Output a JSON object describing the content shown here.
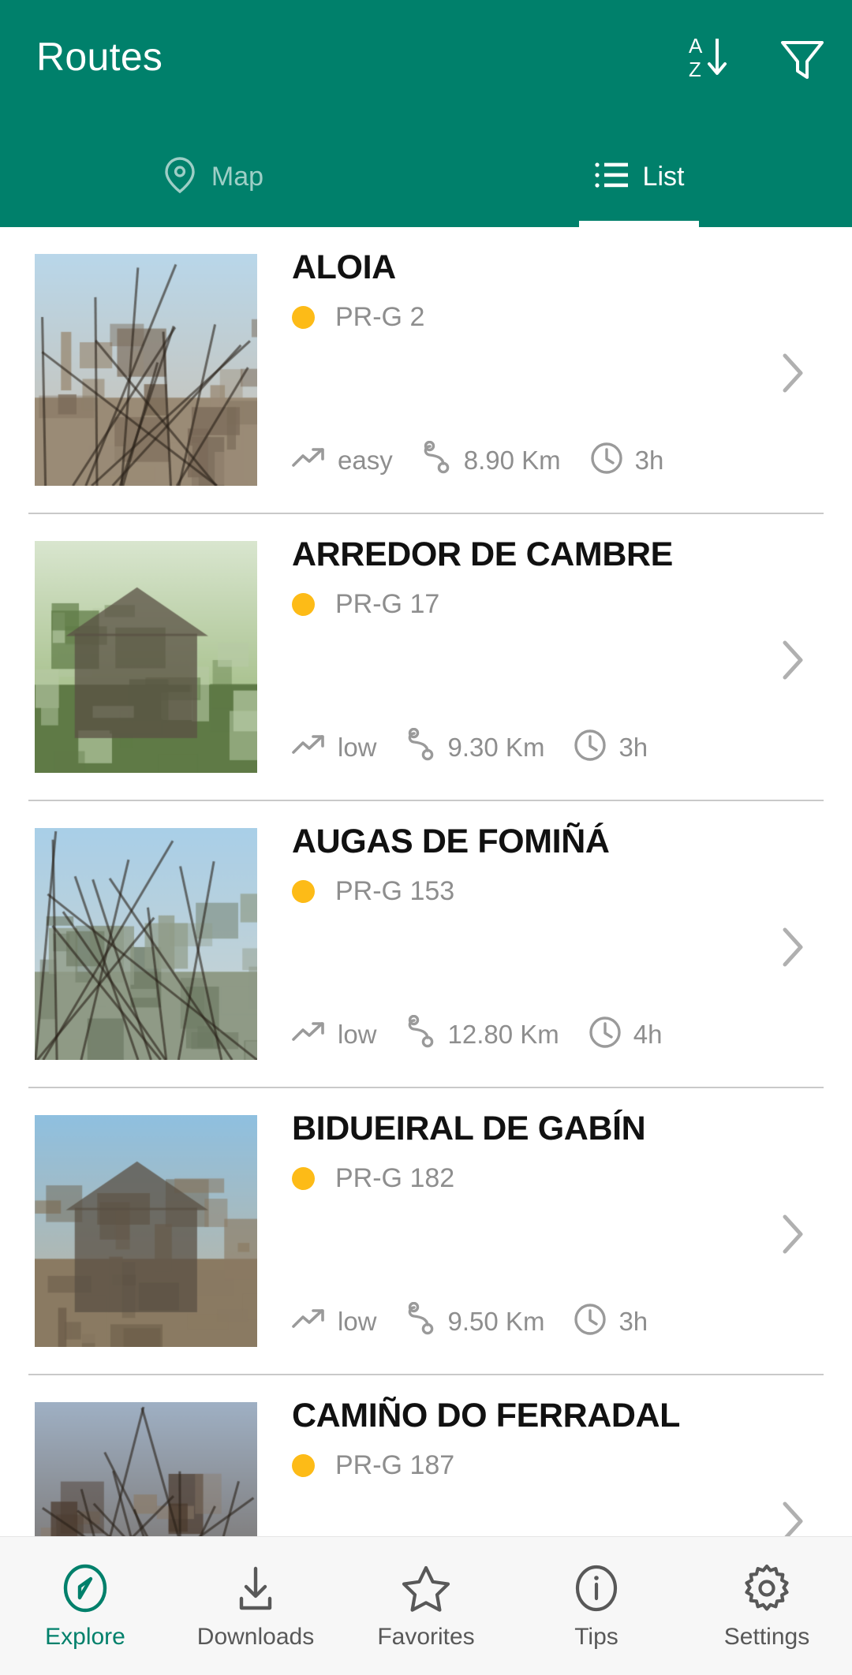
{
  "header": {
    "title": "Routes",
    "sort_icon": "sort-alpha-down-icon",
    "sort_label": "A-Z",
    "filter_icon": "filter-funnel-icon",
    "accent_color": "#00806B"
  },
  "tabs": [
    {
      "label": "Map",
      "icon": "map-pin-icon",
      "active": false
    },
    {
      "label": "List",
      "icon": "list-icon",
      "active": true
    }
  ],
  "routes": [
    {
      "title": "ALOIA",
      "code": "PR-G 2",
      "dot_color": "#FDBB17",
      "difficulty": "easy",
      "distance": "8.90 Km",
      "duration": "3h",
      "thumb_alt": "stone-building-under-bare-trees"
    },
    {
      "title": "ARREDOR DE CAMBRE",
      "code": "PR-G 17",
      "dot_color": "#FDBB17",
      "difficulty": "low",
      "distance": "9.30 Km",
      "duration": "3h",
      "thumb_alt": "romanesque-church-facade"
    },
    {
      "title": "AUGAS DE FOMIÑÁ",
      "code": "PR-G 153",
      "dot_color": "#FDBB17",
      "difficulty": "low",
      "distance": "12.80 Km",
      "duration": "4h",
      "thumb_alt": "stone-path-through-green-meadow"
    },
    {
      "title": "BIDUEIRAL DE GABÍN",
      "code": "PR-G 182",
      "dot_color": "#FDBB17",
      "difficulty": "low",
      "distance": "9.50 Km",
      "duration": "3h",
      "thumb_alt": "church-with-road-signs"
    },
    {
      "title": "CAMIÑO DO FERRADAL",
      "code": "PR-G 187",
      "dot_color": "#FDBB17",
      "difficulty": "",
      "distance": "",
      "duration": "",
      "thumb_alt": "stone-house-with-blue-sky"
    }
  ],
  "stat_icons": {
    "difficulty": "trend-up-arrow-icon",
    "distance": "winding-route-icon",
    "duration": "clock-icon"
  },
  "bottom_nav": [
    {
      "label": "Explore",
      "icon": "compass-icon",
      "active": true
    },
    {
      "label": "Downloads",
      "icon": "download-icon",
      "active": false
    },
    {
      "label": "Favorites",
      "icon": "star-icon",
      "active": false
    },
    {
      "label": "Tips",
      "icon": "info-circle-icon",
      "active": false
    },
    {
      "label": "Settings",
      "icon": "gear-icon",
      "active": false
    }
  ]
}
